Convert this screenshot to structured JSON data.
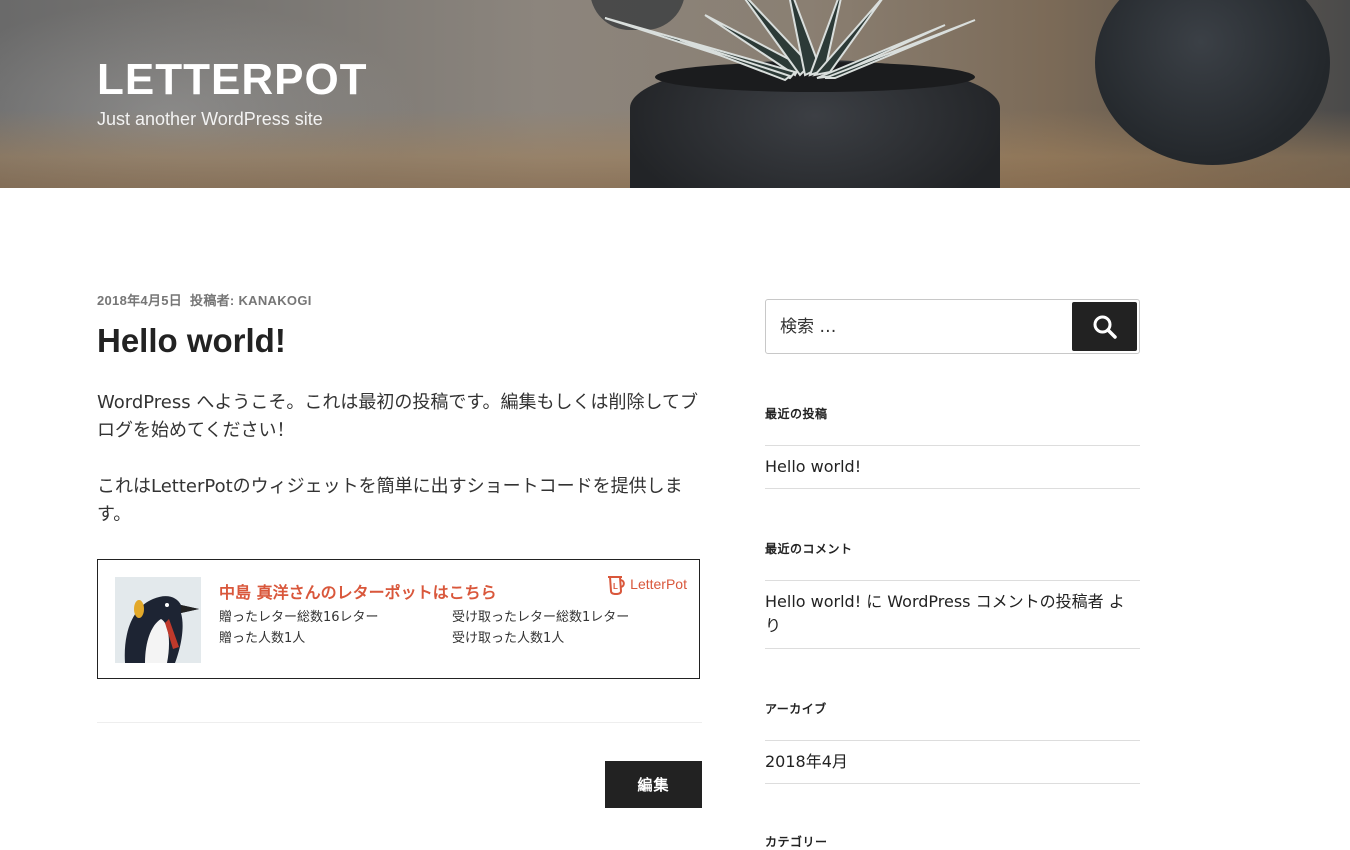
{
  "header": {
    "site_title": "LETTERPOT",
    "site_description": "Just another WordPress site"
  },
  "post": {
    "date": "2018年4月5日",
    "author_prefix": "投稿者:",
    "author": "KANAKOGI",
    "title": "Hello world!",
    "paragraph1": "WordPress へようこそ。これは最初の投稿です。編集もしくは削除してブログを始めてください！",
    "paragraph2": "これはLetterPotのウィジェットを簡単に出すショートコードを提供します。",
    "edit_label": "編集"
  },
  "letterpot_widget": {
    "heading": "中島 真洋さんのレターポットはこちら",
    "logo_text": "LetterPot",
    "sent_letters": "贈ったレター総数16レター",
    "sent_people": "贈った人数1人",
    "received_letters": "受け取ったレター総数1レター",
    "received_people": "受け取った人数1人",
    "accent_color": "#d9573b"
  },
  "sidebar": {
    "search": {
      "placeholder": "検索 …",
      "icon": "search-icon"
    },
    "recent_posts": {
      "title": "最近の投稿",
      "items": [
        "Hello world!"
      ]
    },
    "recent_comments": {
      "title": "最近のコメント",
      "items": [
        "Hello world! に WordPress コメントの投稿者 より"
      ]
    },
    "archives": {
      "title": "アーカイブ",
      "items": [
        "2018年4月"
      ]
    },
    "categories": {
      "title": "カテゴリー"
    }
  }
}
